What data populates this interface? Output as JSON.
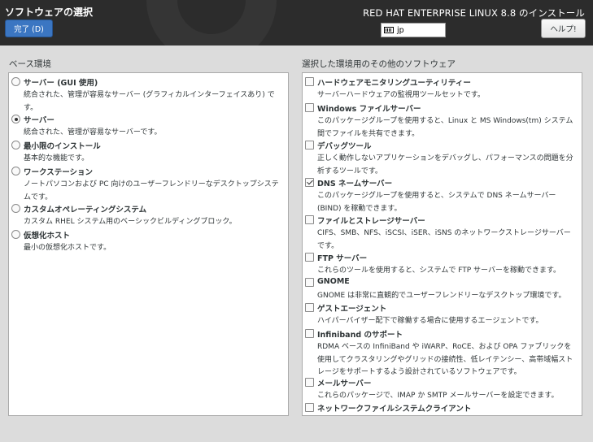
{
  "header": {
    "title": "ソフトウェアの選択",
    "done_label": "完了 (D)",
    "product_title": "RED HAT ENTERPRISE LINUX 8.8 のインストール",
    "keyboard_layout": "jp",
    "help_label": "ヘルプ!"
  },
  "base_env": {
    "title": "ベース環境",
    "items": [
      {
        "name": "サーバー (GUI 使用)",
        "desc": "統合された、管理が容易なサーバー (グラフィカルインターフェイスあり) です。",
        "selected": false
      },
      {
        "name": "サーバー",
        "desc": "統合された、管理が容易なサーバーです。",
        "selected": true
      },
      {
        "name": "最小限のインストール",
        "desc": "基本的な機能です。",
        "selected": false
      },
      {
        "name": "ワークステーション",
        "desc": "ノートパソコンおよび PC 向けのユーザーフレンドリーなデスクトップシステムです。",
        "selected": false
      },
      {
        "name": "カスタムオペレーティングシステム",
        "desc": "カスタム RHEL システム用のベーシックビルディングブロック。",
        "selected": false
      },
      {
        "name": "仮想化ホスト",
        "desc": "最小の仮想化ホストです。",
        "selected": false
      }
    ]
  },
  "addons": {
    "title": "選択した環境用のその他のソフトウェア",
    "items": [
      {
        "name": "ハードウェアモニタリングユーティリティー",
        "desc": "サーバーハードウェアの監視用ツールセットです。",
        "checked": false
      },
      {
        "name": "Windows ファイルサーバー",
        "desc": "このパッケージグループを使用すると、Linux と MS Windows(tm) システム間でファイルを共有できます。",
        "checked": false
      },
      {
        "name": "デバッグツール",
        "desc": "正しく動作しないアプリケーションをデバッグし、パフォーマンスの問題を分析するツールです。",
        "checked": false
      },
      {
        "name": "DNS ネームサーバー",
        "desc": "このパッケージグループを使用すると、システムで DNS ネームサーバー (BIND) を稼動できます。",
        "checked": true
      },
      {
        "name": "ファイルとストレージサーバー",
        "desc": "CIFS、SMB、NFS、iSCSI、iSER、iSNS のネットワークストレージサーバーです。",
        "checked": false
      },
      {
        "name": "FTP サーバー",
        "desc": "これらのツールを使用すると、システムで FTP サーバーを稼動できます。",
        "checked": false
      },
      {
        "name": "GNOME",
        "desc": "GNOME は非常に直観的でユーザーフレンドリーなデスクトップ環境です。",
        "checked": false
      },
      {
        "name": "ゲストエージェント",
        "desc": "ハイパーバイザー配下で稼働する場合に使用するエージェントです。",
        "checked": false
      },
      {
        "name": "Infiniband のサポート",
        "desc": "RDMA ベースの InfiniBand や iWARP、RoCE、および OPA ファブリックを使用してクラスタリングやグリッドの接続性、低レイテンシー、高帯域幅ストレージをサポートするよう設計されているソフトウェアです。",
        "checked": false
      },
      {
        "name": "メールサーバー",
        "desc": "これらのパッケージで、IMAP か SMTP メールサーバーを設定できます。",
        "checked": false
      },
      {
        "name": "ネットワークファイルシステムクライアント",
        "desc": "",
        "checked": false
      }
    ]
  }
}
